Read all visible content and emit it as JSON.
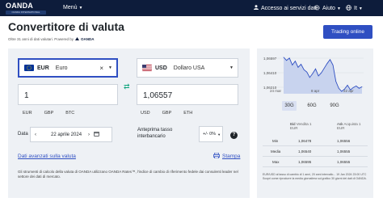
{
  "nav": {
    "logo": "OANDA",
    "logo_sub": "OANDA INTERNATIONAL",
    "menu_label": "Menù",
    "login_label": "Accesso ai servizi dati",
    "help_label": "Aiuto",
    "lang_label": "It"
  },
  "page": {
    "title": "Convertitore di valuta",
    "subtitle": "Oltre 31 anni di dati valutari. Powered by",
    "subtitle_brand": "OANDA",
    "trade_button": "Trading online"
  },
  "from": {
    "code": "EUR",
    "name": "Euro",
    "amount": "1",
    "quick": [
      "EUR",
      "GBP",
      "BTC"
    ],
    "flag_color": "#003399"
  },
  "to": {
    "code": "USD",
    "name": "Dollaro USA",
    "amount": "1,06557",
    "quick": [
      "USD",
      "GBP",
      "ETH"
    ]
  },
  "date": {
    "label": "Data",
    "value": "22 aprile 2024"
  },
  "spread": {
    "label_1": "Anteprima tasso",
    "label_2": "interbancario",
    "value": "+/- 0%"
  },
  "links": {
    "advanced": "Dati avanzati sulla valuta",
    "print": "Stampa"
  },
  "note": "Gli strumenti di calcolo della valuta di OANDA utilizzano OANDA Rates™, l'indice di cambio di riferimento fedele dai consulenti leader nel settore dei dati di mercato.",
  "chart_data": {
    "type": "line",
    "y_ticks": [
      "1,06597",
      "1,06410",
      "1,06210"
    ],
    "x_labels": [
      "24 mar",
      "8 apr",
      "22 apr"
    ],
    "ylim": [
      1.0615,
      1.0665
    ],
    "values": [
      1.0662,
      1.0658,
      1.0661,
      1.0652,
      1.0657,
      1.0649,
      1.0653,
      1.0646,
      1.0643,
      1.0636,
      1.0641,
      1.0647,
      1.0638,
      1.0642,
      1.0648,
      1.0654,
      1.0659,
      1.0652,
      1.0631,
      1.0622,
      1.0618,
      1.0621,
      1.0626,
      1.062,
      1.0623,
      1.0625,
      1.0622,
      1.0624
    ],
    "line_color": "#2f4fc2",
    "fill_color": "#c8d3ee"
  },
  "periods": [
    "30G",
    "60G",
    "90G"
  ],
  "active_period": "30G",
  "stats": {
    "headers": [
      "Bid",
      "Vendita 1 EUR",
      "Ask",
      "Acquista 1 EUR"
    ],
    "rows": [
      {
        "label": "Min",
        "bid": "1,06478",
        "ask": "1,06556"
      },
      {
        "label": "Media",
        "bid": "1,06540",
        "ask": "1,06555"
      },
      {
        "label": "Max",
        "bid": "1,06595",
        "ask": "1,06555"
      }
    ]
  },
  "rate_note": "EUR/USD al tasso di cambio di 1 anni, 20 anni intervallo... 19 Jan 2024 23:00 UTC",
  "rate_note_2": "Scopri come riprodurre la media giornaliera sul grafico 30 giorni dei dati di OANDA."
}
